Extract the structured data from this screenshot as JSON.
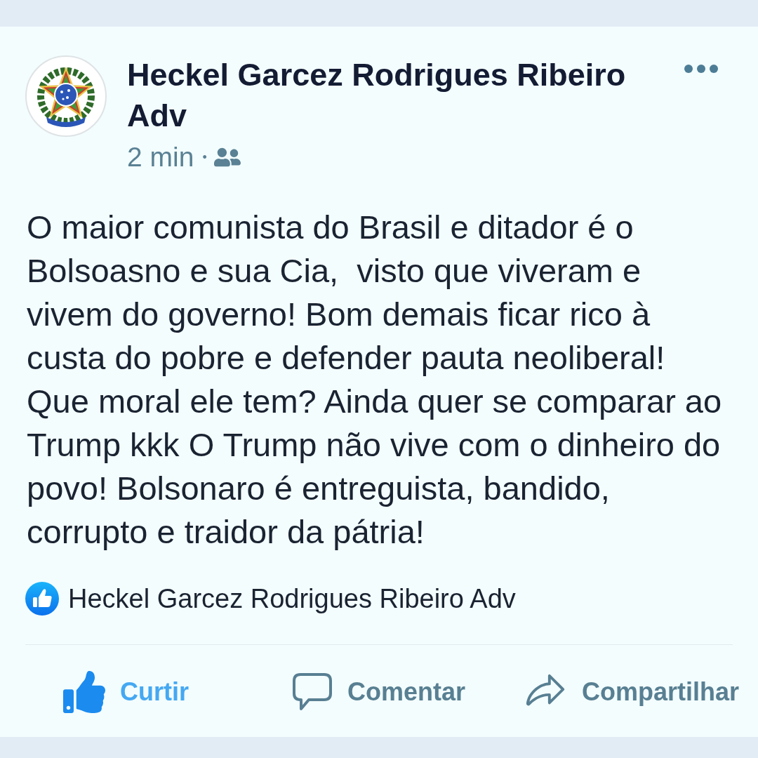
{
  "post": {
    "author": "Heckel Garcez Rodrigues Ribeiro Adv",
    "time": "2 min",
    "separator": "•",
    "body": "O maior comunista do Brasil e ditador é o Bolsoasno e sua Cia,  visto que viveram e vivem do governo! Bom demais ficar rico à custa do pobre e defender pauta neoliberal! Que moral ele tem? Ainda quer se comparar ao Trump kkk O Trump não vive com o dinheiro do povo! Bolsonaro é entreguista, bandido, corrupto e traidor da pátria!",
    "reactions": {
      "names": "Heckel Garcez Rodrigues Ribeiro Adv"
    },
    "actions": [
      {
        "kind": "like",
        "label": "Curtir",
        "active": true
      },
      {
        "kind": "comment",
        "label": "Comentar",
        "active": false
      },
      {
        "kind": "share",
        "label": "Compartilhar",
        "active": false
      }
    ]
  }
}
